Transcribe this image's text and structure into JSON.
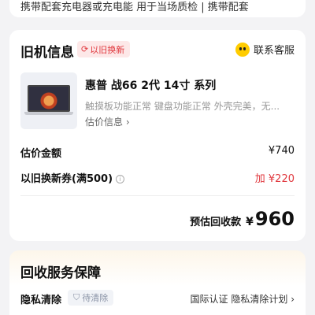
{
  "top_card": {
    "text": "携带配套充电器或充电能 用于当场质检 | 携带配套"
  },
  "old_device": {
    "title": "旧机信息",
    "badge_label": "以旧换新",
    "badge_icon": "refresh-icon",
    "service_label": "联系客服",
    "service_icon": "smile-icon",
    "product_name": "惠普 战66 2代 14寸 系列",
    "product_desc": "触摸板功能正常 键盘功能正常 外壳完美，无...",
    "estimate_link": "估价信息",
    "chevron": "›"
  },
  "pricing": {
    "estimate_label": "估价金额",
    "estimate_value": "¥740",
    "coupon_label": "以旧换新券(满500)",
    "info_glyph": "i",
    "coupon_prefix": "加",
    "coupon_value": "¥220",
    "coupon_color": "#e0383e",
    "total_label": "预估回收款",
    "total_currency": "¥",
    "total_amount": "960"
  },
  "guarantee": {
    "title": "回收服务保障",
    "privacy_label": "隐私清除",
    "pending_label": "待清除",
    "pending_icon": "shield-icon",
    "privacy_right": "国际认证 隐私清除计划",
    "chevron": "›"
  }
}
